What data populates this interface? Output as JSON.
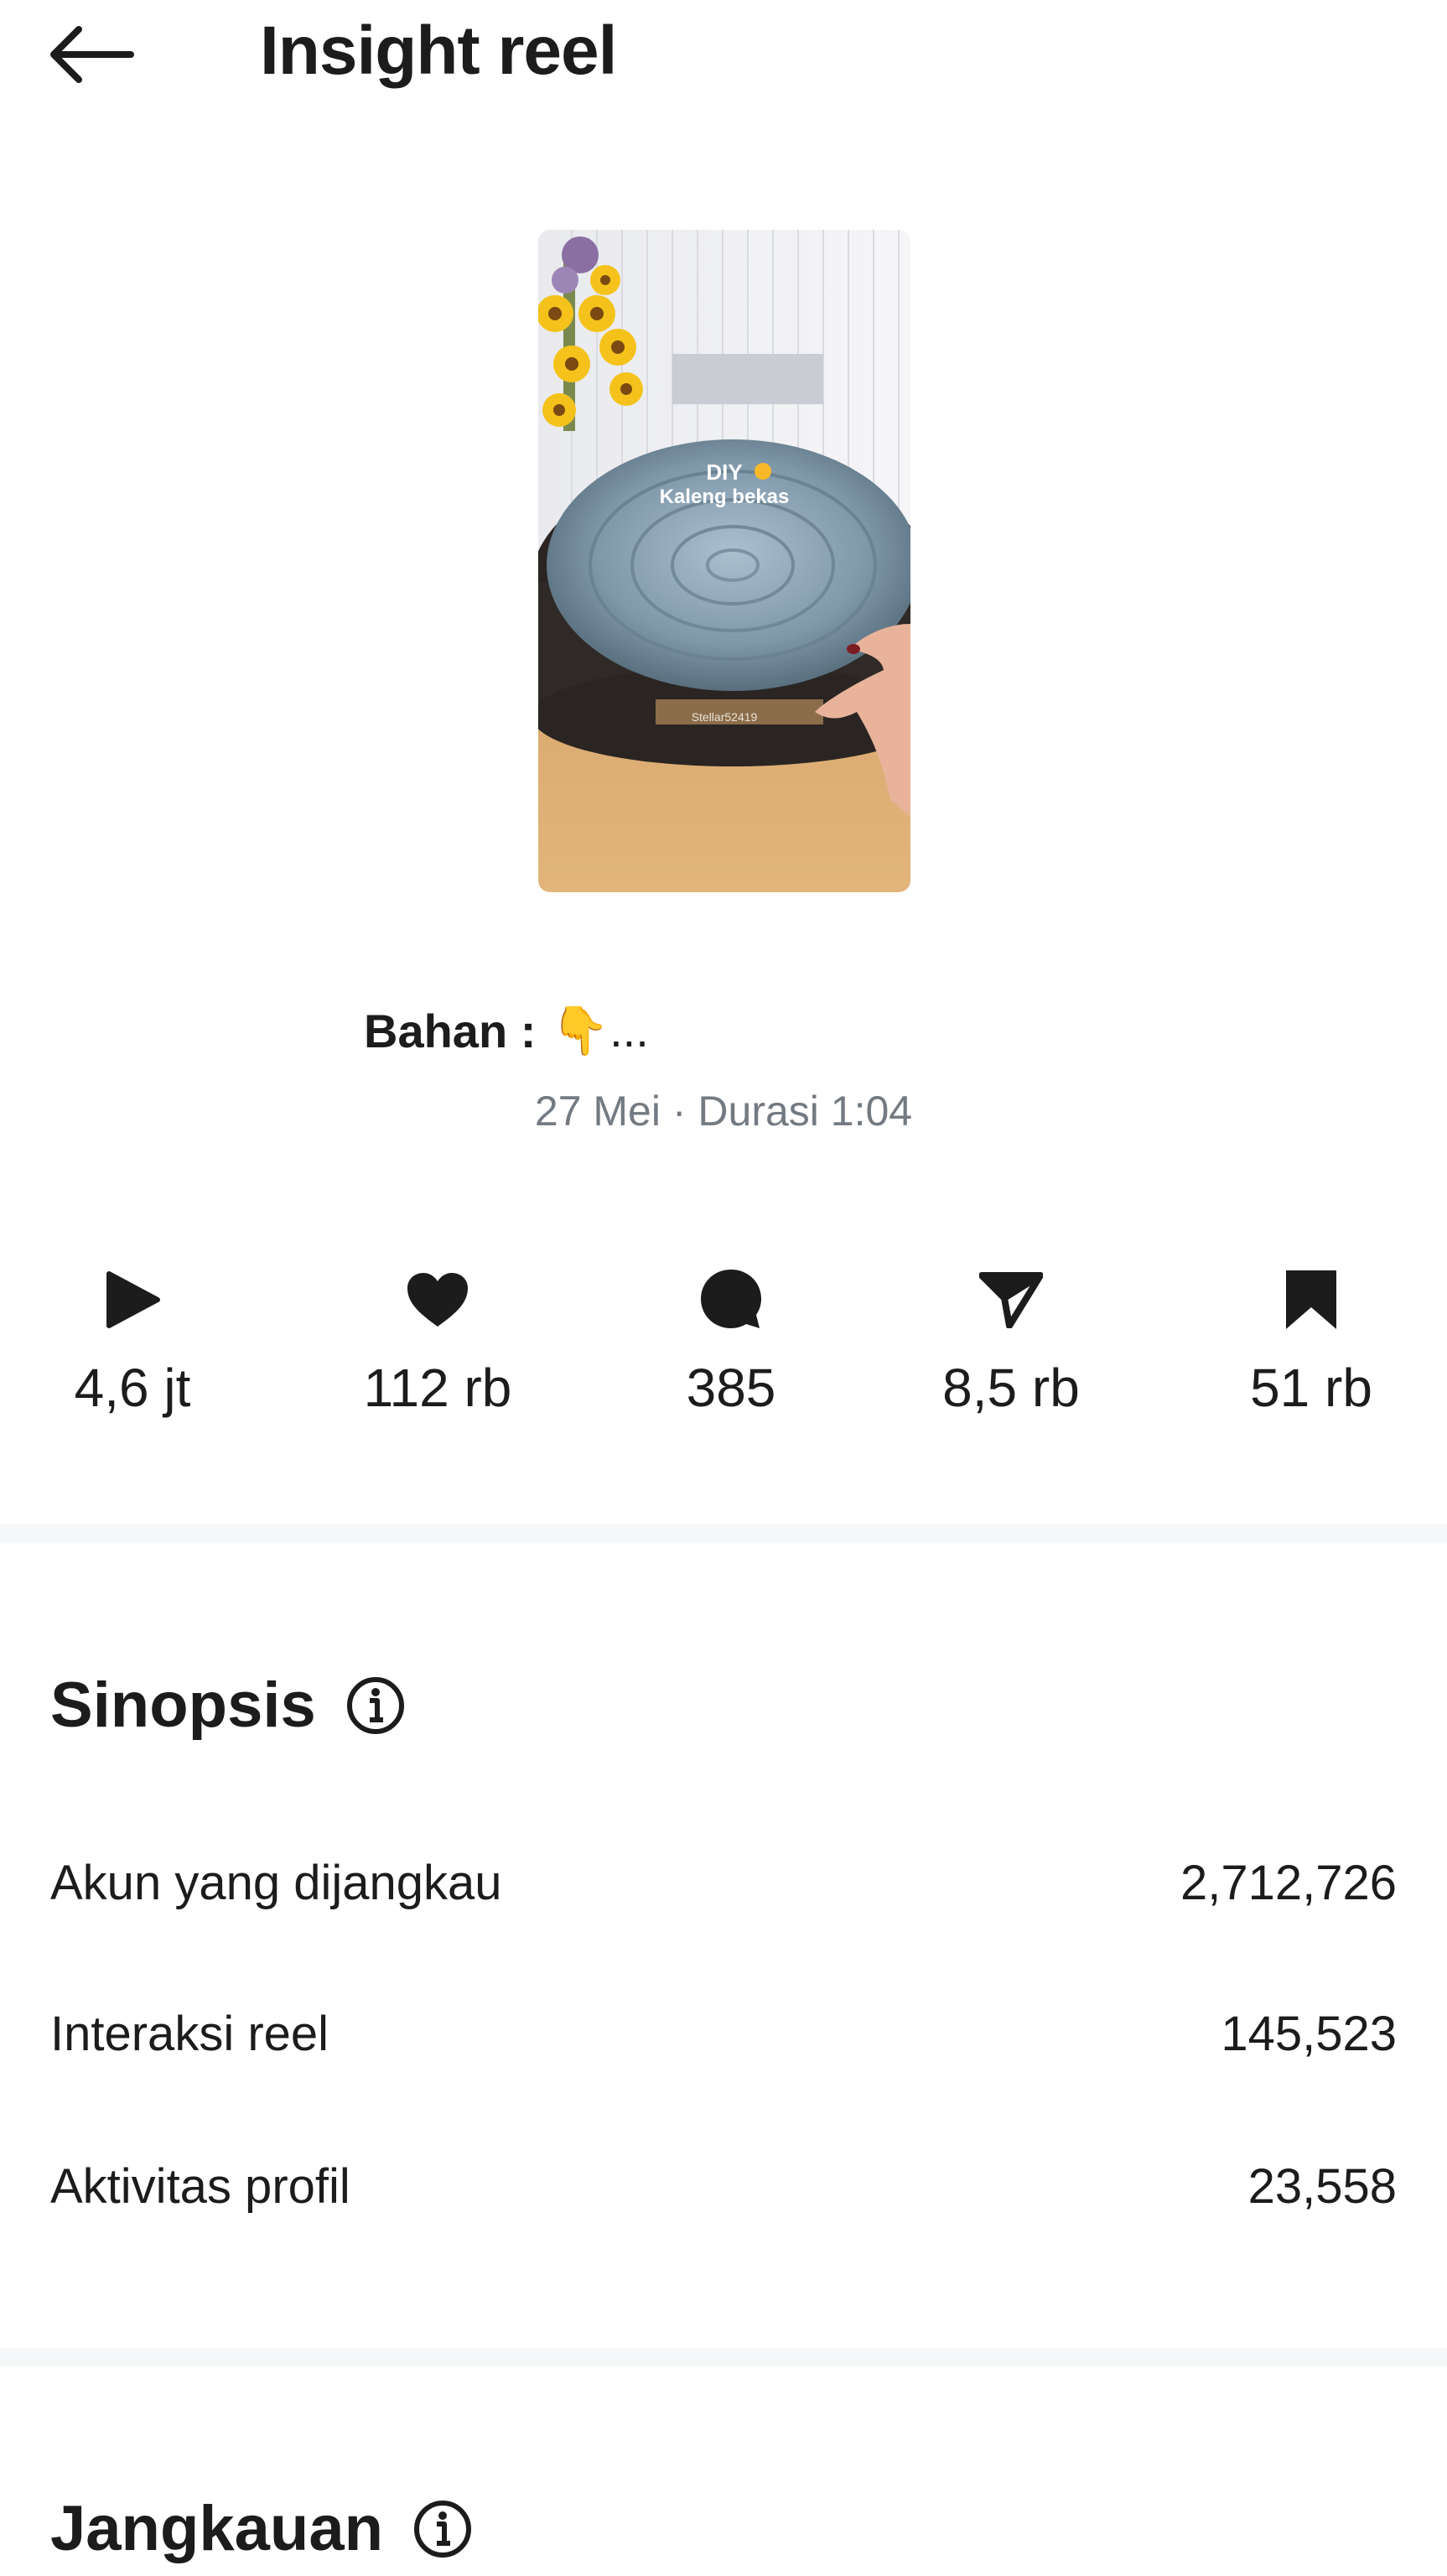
{
  "header": {
    "title": "Insight reel",
    "back_icon": "arrow-left-icon"
  },
  "reel": {
    "thumbnail_text_line1": "DIY",
    "thumbnail_text_line2": "Kaleng bekas",
    "thumbnail_label": "Stellar52419",
    "caption": "Bahan :",
    "caption_emoji": "👇...",
    "meta": "27 Mei · Durasi 1:04"
  },
  "stats": [
    {
      "icon": "play-icon",
      "value": "4,6 jt"
    },
    {
      "icon": "heart-icon",
      "value": "112 rb"
    },
    {
      "icon": "comment-icon",
      "value": "385"
    },
    {
      "icon": "share-icon",
      "value": "8,5 rb"
    },
    {
      "icon": "bookmark-icon",
      "value": "51 rb"
    }
  ],
  "sinopsis": {
    "title": "Sinopsis",
    "rows": [
      {
        "label": "Akun yang dijangkau",
        "value": "2,712,726"
      },
      {
        "label": "Interaksi reel",
        "value": "145,523"
      },
      {
        "label": "Aktivitas profil",
        "value": "23,558"
      }
    ]
  },
  "jangkauan": {
    "title": "Jangkauan"
  },
  "colors": {
    "text": "#1c1c1c",
    "secondary_text": "#737a82",
    "divider": "#f5f7f8"
  }
}
